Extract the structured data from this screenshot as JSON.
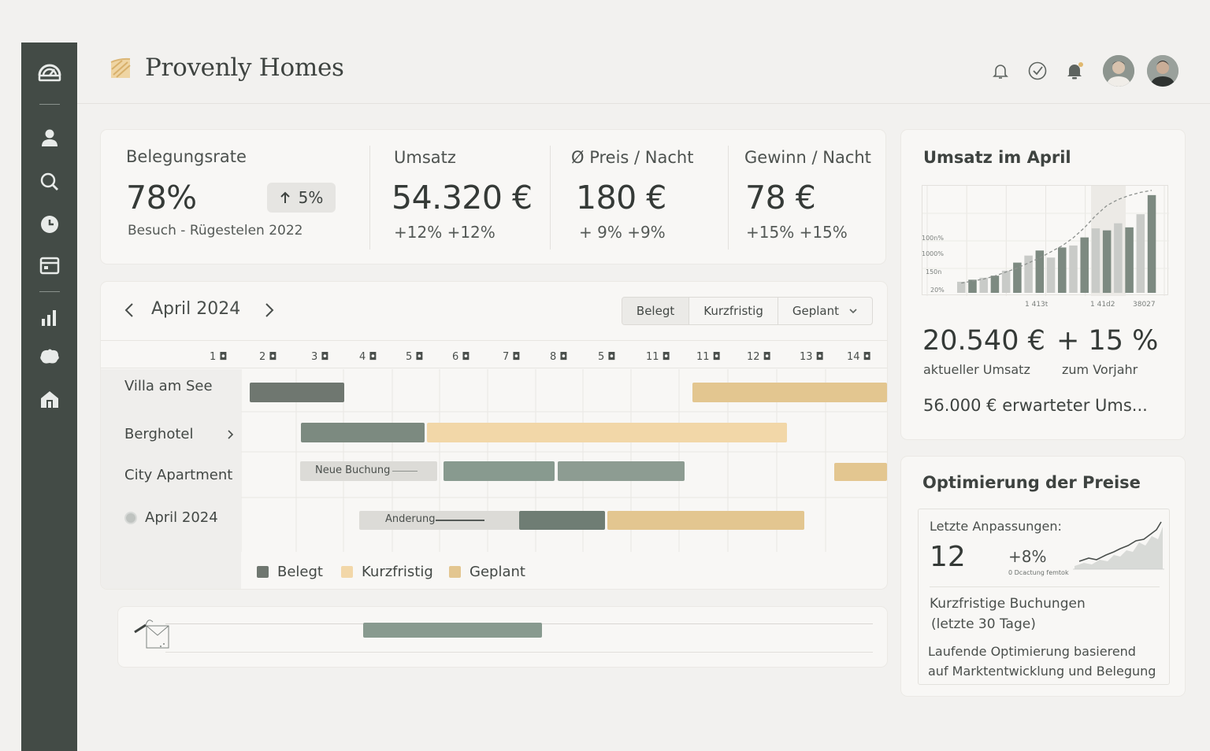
{
  "app": {
    "name": "Provenly Homes"
  },
  "sidebar": {
    "icons": [
      "dashboard-icon",
      "user-icon",
      "search-icon",
      "clock-icon",
      "calendar-icon",
      "chart-icon",
      "puzzle-icon",
      "home-icon"
    ]
  },
  "kpis": {
    "occupancy": {
      "label": "Belegungsrate",
      "value": "78%",
      "change": "5%",
      "subtitle": "Besuch - Rügestelen 2022"
    },
    "revenue": {
      "label": "Umsatz",
      "value": "54.320 €",
      "change": "+12% +12%"
    },
    "price": {
      "label": "Ø Preis / Nacht",
      "value": "180 €",
      "change": "+ 9% +9%"
    },
    "profit": {
      "label": "Gewinn / Nacht",
      "value": "78 €",
      "change": "+15% +15%"
    }
  },
  "calendar": {
    "month": "April 2024",
    "filters": [
      "Belegt",
      "Kurzfristig",
      "Geplant"
    ],
    "days": [
      "1 ◘",
      "2 ◘",
      "3 ◘",
      "4 ◘",
      "5 ◘",
      "6 ◘",
      "7 ◘",
      "8 ◘",
      "5 ◘",
      "11 ◘",
      "11 ◘",
      "12 ◘",
      "13 ◘",
      "14 ◘"
    ],
    "rows": [
      "Villa am See",
      "Berghotel",
      "City Apartment",
      "April 2024"
    ],
    "bar_labels": {
      "new_booking": "Neue Buchung",
      "change": "Anderung"
    },
    "legend": [
      "Belegt",
      "Kurzfristig",
      "Geplant"
    ]
  },
  "revenue_card": {
    "title": "Umsatz im April",
    "current_value": "20.540 €",
    "current_label": "aktueller Umsatz",
    "change_value": "+ 15 %",
    "change_label": "zum Vorjahr",
    "expected": "56.000 € erwarteter Ums..."
  },
  "pricing_card": {
    "title": "Optimierung der Preise",
    "last_label": "Letzte Anpassungen:",
    "count": "12",
    "change": "+8%",
    "mini_note": "0  Dcactung femtok",
    "short_term": "Kurzfristige Buchungen",
    "short_term_period": "(letzte 30 Tage)",
    "note_line1": "Laufende Optimierung basierend",
    "note_line2": "auf Marktentwicklung und Belegung"
  },
  "colors": {
    "sidebar": "#434b46",
    "belegt": "#6f7770",
    "belegt_light": "#889a8f",
    "kurzfristig": "#f2d7a8",
    "geplant": "#e3c690",
    "neutral_bar": "#d9d8d4"
  },
  "chart_data": {
    "type": "bar",
    "title": "Umsatz im April",
    "ytick_labels": [
      "100n%",
      "1000%",
      "150n",
      "20%"
    ],
    "xtick_labels": [
      "1 413t",
      "1 41d2",
      "38027"
    ],
    "values": [
      0.11,
      0.13,
      0.15,
      0.17,
      0.22,
      0.3,
      0.37,
      0.42,
      0.35,
      0.45,
      0.47,
      0.55,
      0.64,
      0.62,
      0.69,
      0.65,
      0.78,
      0.97
    ],
    "trend": [
      0.05,
      0.07,
      0.09,
      0.12,
      0.16,
      0.2,
      0.25,
      0.3,
      0.36,
      0.42,
      0.5,
      0.6,
      0.72,
      0.82,
      0.88,
      0.92,
      0.95,
      0.97
    ]
  }
}
